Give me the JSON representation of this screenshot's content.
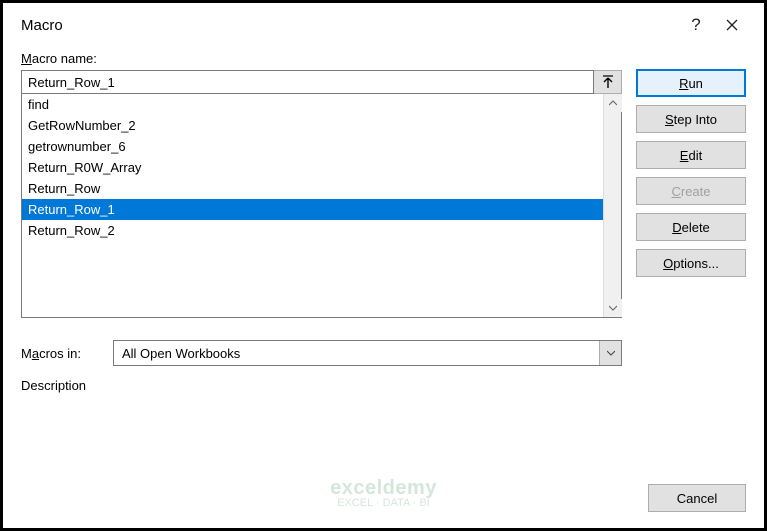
{
  "title": "Macro",
  "labels": {
    "macro_name": "Macro name:",
    "macros_in": "Macros in:",
    "description": "Description"
  },
  "macro_name_value": "Return_Row_1",
  "macro_list": [
    "find",
    "GetRowNumber_2",
    "getrownumber_6",
    "Return_R0W_Array",
    "Return_Row",
    "Return_Row_1",
    "Return_Row_2"
  ],
  "selected_index": 5,
  "macros_in_value": "All Open Workbooks",
  "buttons": {
    "run": "Run",
    "step_into": "Step Into",
    "edit": "Edit",
    "create": "Create",
    "delete": "Delete",
    "options": "Options...",
    "cancel": "Cancel"
  },
  "watermark": {
    "brand": "exceldemy",
    "tagline": "EXCEL · DATA · BI"
  }
}
